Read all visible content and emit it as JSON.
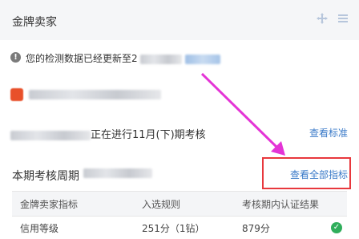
{
  "header": {
    "title": "金牌卖家",
    "icons": [
      "move-icon",
      "menu-icon"
    ]
  },
  "notice": {
    "text": "您的检测数据已经更新至2"
  },
  "status": {
    "text": "正在进行11月(下)期考核",
    "link": "查看标准"
  },
  "period": {
    "label": "本期考核周期",
    "link": "查看全部指标"
  },
  "table": {
    "headers": [
      "金牌卖家指标",
      "入选规则",
      "考核期内认证结果"
    ],
    "rows": [
      {
        "metric": "信用等级",
        "rule": "251分（1钻）",
        "result": "879分"
      }
    ]
  },
  "colors": {
    "accent_link": "#3a7ac8",
    "highlight_box": "#e8383d",
    "arrow": "#e434d6",
    "pass": "#2fae5b"
  }
}
